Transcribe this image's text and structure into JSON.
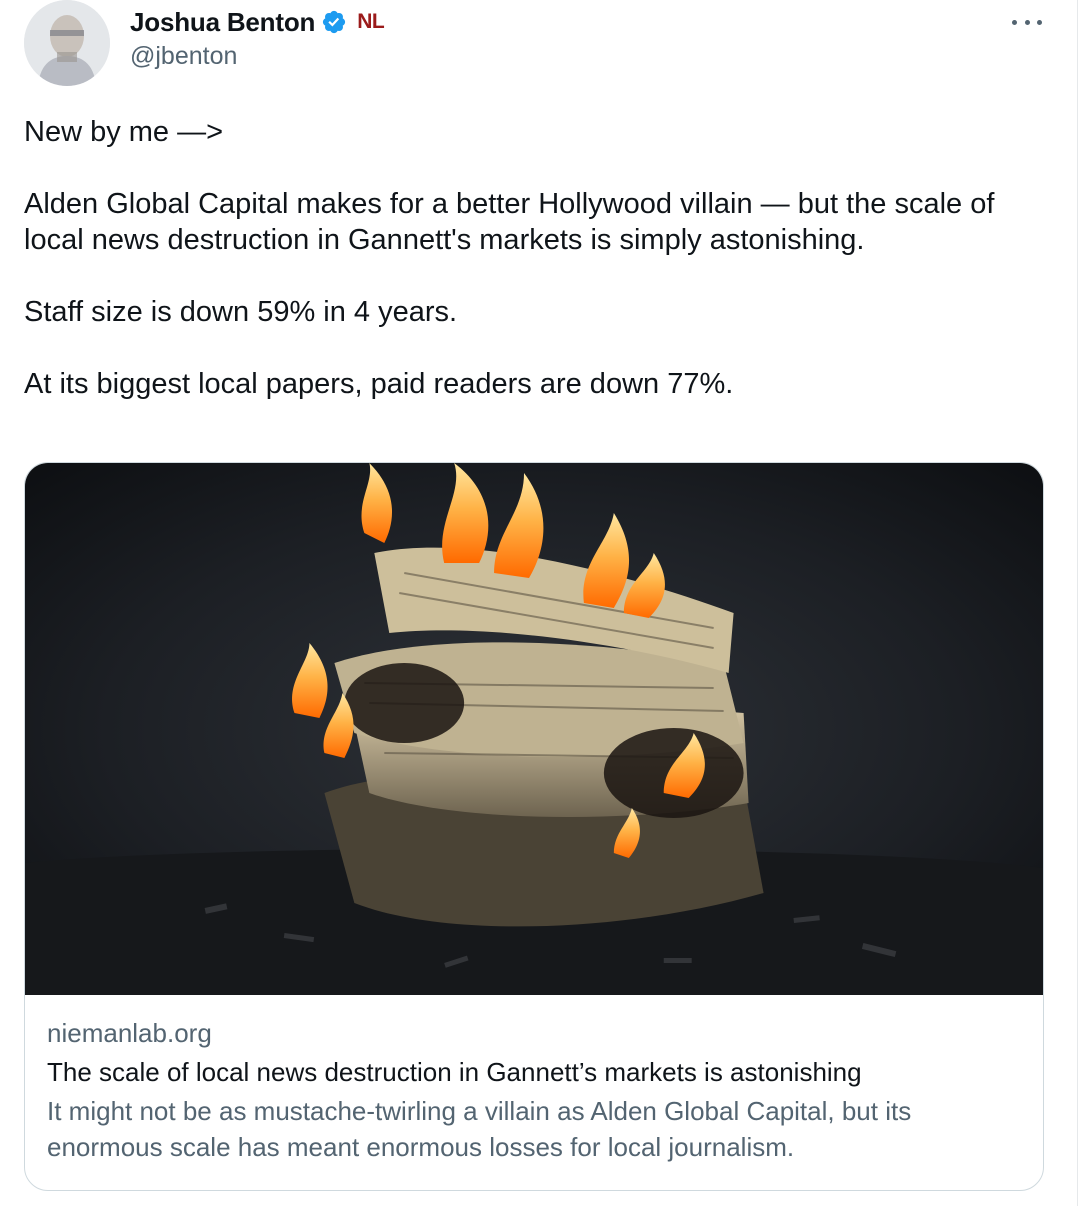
{
  "author": {
    "display_name": "Joshua Benton",
    "handle": "@jbenton",
    "affiliate_badge": "NL",
    "verified": true,
    "avatar_icon": "user-avatar-photo",
    "verified_icon": "verified-badge-icon"
  },
  "tweet": {
    "text": "New by me —>\n\nAlden Global Capital makes for a better Hollywood villain — but the scale of local news destruction in Gannett's markets is simply astonishing.\n\nStaff size is down 59% in 4 years.\n\nAt its biggest local papers, paid readers are down 77%."
  },
  "link_card": {
    "image_icon": "burning-newspapers-image",
    "domain": "niemanlab.org",
    "title": "The scale of local news destruction in Gannett’s markets is astonishing",
    "description": "It might not be as mustache-twirling a villain as Alden Global Capital, but its enormous scale has meant enormous losses for local journalism."
  },
  "colors": {
    "text_primary": "#0f1419",
    "text_secondary": "#536471",
    "verified_blue": "#1d9bf0",
    "border": "#cfd9de",
    "affiliate_red": "#9b1b1b"
  }
}
